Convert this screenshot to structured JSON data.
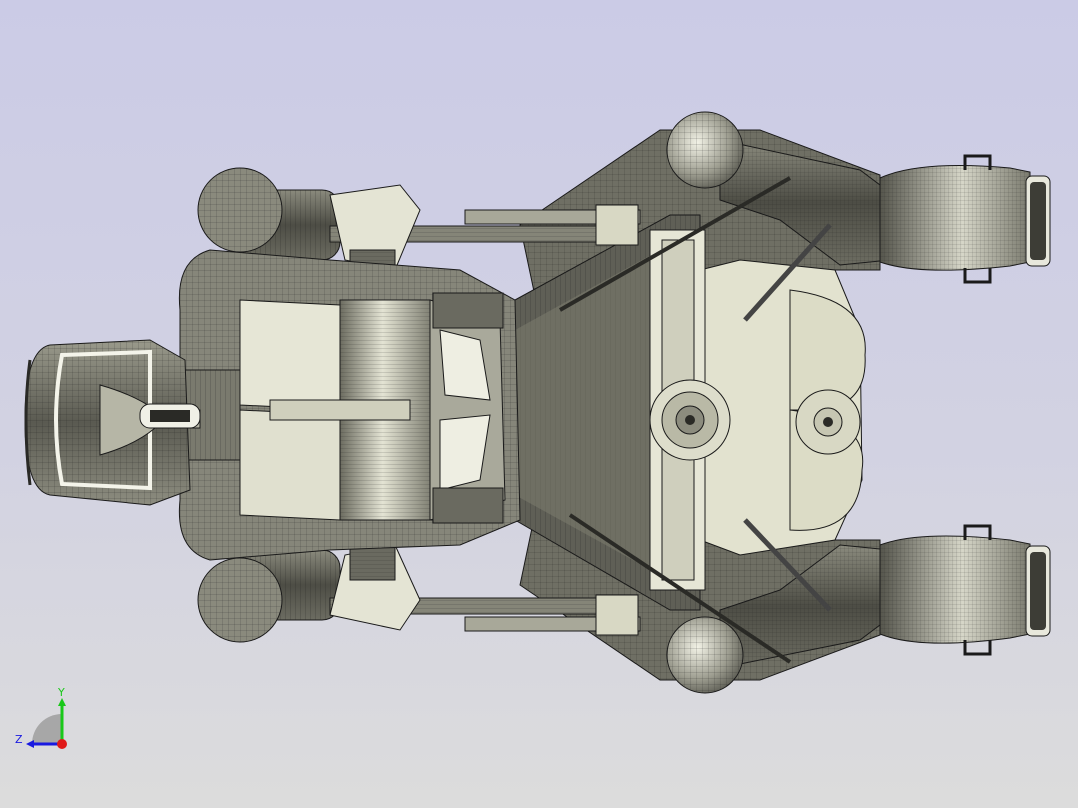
{
  "viewport": {
    "background_top": "#cbcbe6",
    "background_bottom": "#dcdcdc",
    "model": "cad-robot-top-view-wireframe",
    "shade_colors": {
      "dark": "#4a4a42",
      "mid": "#6e6e63",
      "light": "#a5a596",
      "highlight": "#e6e6d8",
      "cream": "#d8d8c2",
      "edge": "#1a1a1a"
    }
  },
  "triad": {
    "y_label": "Y",
    "z_label": "Z",
    "y_color": "#19c819",
    "z_color": "#1919e0",
    "x_color": "#e01919"
  }
}
